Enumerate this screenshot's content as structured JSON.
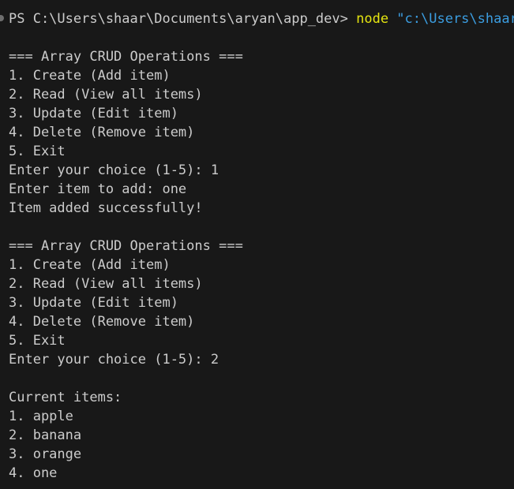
{
  "prompt": {
    "path": "PS C:\\Users\\shaar\\Documents\\aryan\\app_dev> ",
    "command": "node",
    "argument": " \"c:\\Users\\shaar\\"
  },
  "menu_title": "=== Array CRUD Operations ===",
  "menu_options": [
    "1. Create (Add item)",
    "2. Read (View all items)",
    "3. Update (Edit item)",
    "4. Delete (Remove item)",
    "5. Exit"
  ],
  "session1": {
    "choice_line": "Enter your choice (1-5): 1",
    "add_line": "Enter item to add: one",
    "result_line": "Item added successfully!"
  },
  "session2": {
    "choice_line": "Enter your choice (1-5): 2",
    "items_header": "Current items:",
    "items": [
      "1. apple",
      "2. banana",
      "3. orange",
      "4. one"
    ]
  },
  "colors": {
    "background": "#181818",
    "text": "#cccccc",
    "command": "#e5e510",
    "string": "#3b9de0"
  }
}
